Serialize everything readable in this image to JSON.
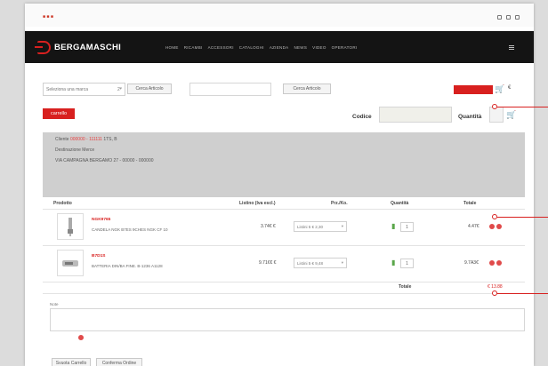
{
  "brand": {
    "name": "BERGAMASCHI"
  },
  "header": {
    "flags": "■ ■ ■",
    "menu": [
      "HOME",
      "RICAMBI",
      "ACCESSORI",
      "CATALOGHI",
      "AZIENDA",
      "NEWS",
      "VIDEO",
      "OPERATORI"
    ]
  },
  "search": {
    "brand_select": "Seleziona una marca",
    "brand_select_count": "2",
    "button1": "Cerca Articolo",
    "button2": "Cerca Articolo"
  },
  "cart": {
    "badge": "carrello",
    "codice_label": "Codice",
    "quantita_label": "Quantità",
    "euro": "€"
  },
  "info_panel": {
    "line1_prefix": "Cliente",
    "line1_red": "000000 - 111111",
    "line1_suffix": "1TS, B",
    "line2": "Destinazione Merce",
    "line3": "VIA CAMPAGNA BERGAMO 27 - 00000 - 000000"
  },
  "table": {
    "headers": {
      "product": "Prodotto",
      "list_price": "Listino (Iva escl.)",
      "prz": "Prz./Ko.",
      "quantity": "Quantità",
      "total": "Totale"
    },
    "rows": [
      {
        "code": "NGK9765",
        "desc": "CANDELA NGK B7ES 9CHES NGK CF 10",
        "price": "3.74€ €",
        "option": "Listini 5 € 2,30",
        "qty": "1",
        "total": "4.47€"
      },
      {
        "code": "B7D1S",
        "desc": "BATTERIA DIN/BA FINE. B-1236 A1128",
        "price": "9.71€€ €",
        "option": "Listini 5 € 9,48",
        "qty": "1",
        "total": "9.7A3€"
      }
    ],
    "total_label": "Totale",
    "total_value": "€ 13.88"
  },
  "notes": {
    "label": "Note"
  },
  "actions": {
    "clear_cart": "Svuota Carrello",
    "confirm_order": "Conferma Ordine"
  },
  "colors": {
    "accent": "#d8201f",
    "navbar": "#141414",
    "panel": "#cfcfcf"
  }
}
